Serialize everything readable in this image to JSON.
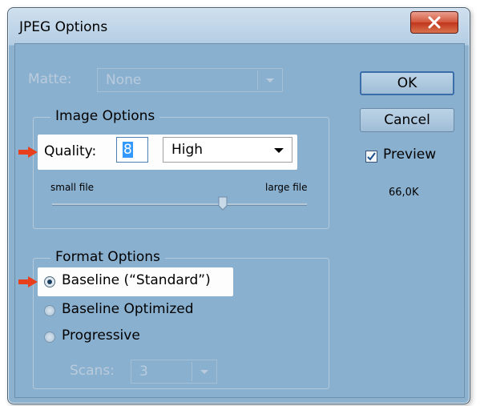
{
  "window": {
    "title": "JPEG Options",
    "close_glyph": "X"
  },
  "matte": {
    "label": "Matte:",
    "value": "None"
  },
  "image_options": {
    "legend": "Image Options",
    "quality_label": "Quality:",
    "quality_value": "8",
    "quality_preset": "High",
    "small_file_label": "small file",
    "large_file_label": "large file",
    "quality_slider_fraction": 0.67
  },
  "format_options": {
    "legend": "Format Options",
    "baseline_standard": "Baseline (“Standard”)",
    "baseline_optimized": "Baseline Optimized",
    "progressive": "Progressive",
    "scans_label": "Scans:",
    "scans_value": "3"
  },
  "buttons": {
    "ok": "OK",
    "cancel": "Cancel"
  },
  "preview": {
    "label": "Preview",
    "checked": true,
    "file_size": "66,0K"
  },
  "colors": {
    "annotation_arrow": "#e8401c",
    "dialog_bg": "#8ab0cf",
    "close_button": "#c9472b"
  }
}
